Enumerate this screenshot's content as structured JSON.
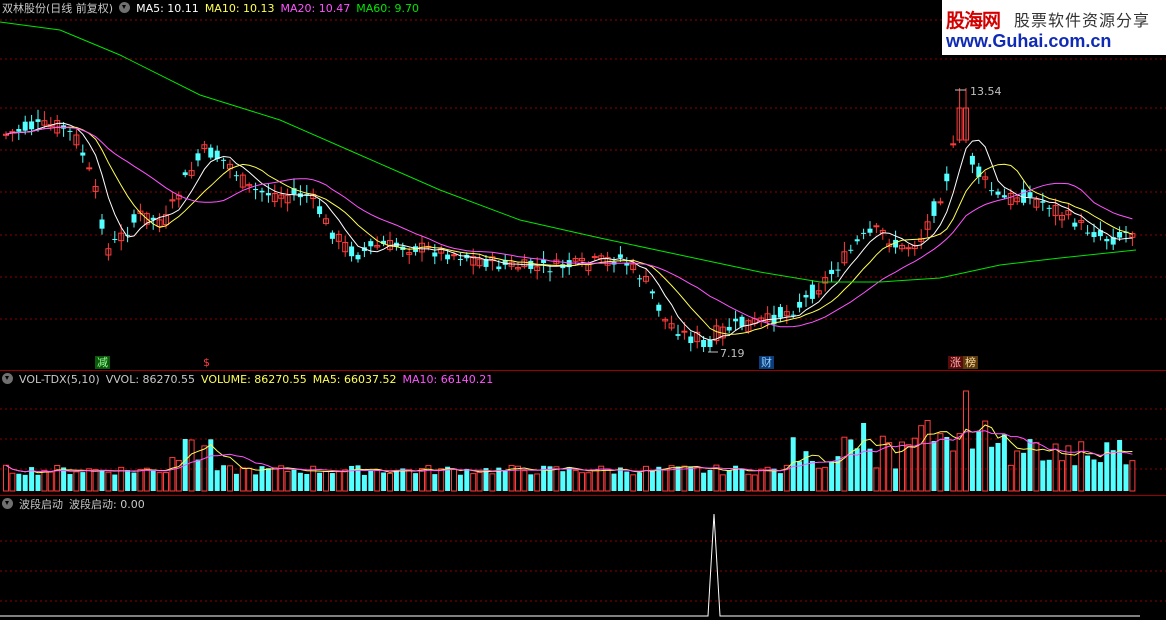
{
  "price_legend": {
    "title": "双林股份(日线 前复权)",
    "ma5": "MA5: 10.11",
    "ma10": "MA10: 10.13",
    "ma20": "MA20: 10.47",
    "ma60": "MA60: 9.70"
  },
  "vol_legend": {
    "name": "VOL-TDX(5,10)",
    "vvol": "VVOL: 86270.55",
    "volume": "VOLUME: 86270.55",
    "ma5": "MA5: 66037.52",
    "ma10": "MA10: 66140.21"
  },
  "ind_legend": {
    "name": "波段启动",
    "value": "波段启动: 0.00"
  },
  "annotations": {
    "high_label": "13.54",
    "low_label": "7.19"
  },
  "markers": {
    "m1": "减",
    "m2": "$",
    "m3": "财",
    "m4": "涨",
    "m5": "榜"
  },
  "brand": {
    "name": "股海网",
    "slogan": "股票软件资源分享",
    "url": "www.Guhai.com.cn"
  },
  "colors": {
    "up": "#ff3c3c",
    "down": "#54ffff",
    "ma5": "#ffffff",
    "ma10": "#ffff54",
    "ma20": "#ff54ff",
    "ma60": "#00e600",
    "grid": "#8b0000"
  },
  "chart_data": [
    {
      "type": "candlestick",
      "title": "双林股份(日线 前复权)",
      "ylim": [
        6.8,
        15.2
      ],
      "series": [
        {
          "name": "MA5",
          "last": 10.11
        },
        {
          "name": "MA10",
          "last": 10.13
        },
        {
          "name": "MA20",
          "last": 10.47
        },
        {
          "name": "MA60",
          "last": 9.7
        }
      ],
      "annotations": [
        {
          "label": "13.54",
          "value": 13.54
        },
        {
          "label": "7.19",
          "value": 7.19
        }
      ]
    },
    {
      "type": "bar",
      "title": "VOL-TDX(5,10)",
      "series": [
        {
          "name": "VVOL",
          "last": 86270.55
        },
        {
          "name": "MA5",
          "last": 66037.52
        },
        {
          "name": "MA10",
          "last": 66140.21
        }
      ]
    },
    {
      "type": "line",
      "title": "波段启动",
      "series": [
        {
          "name": "波段启动",
          "last": 0.0
        }
      ]
    }
  ]
}
